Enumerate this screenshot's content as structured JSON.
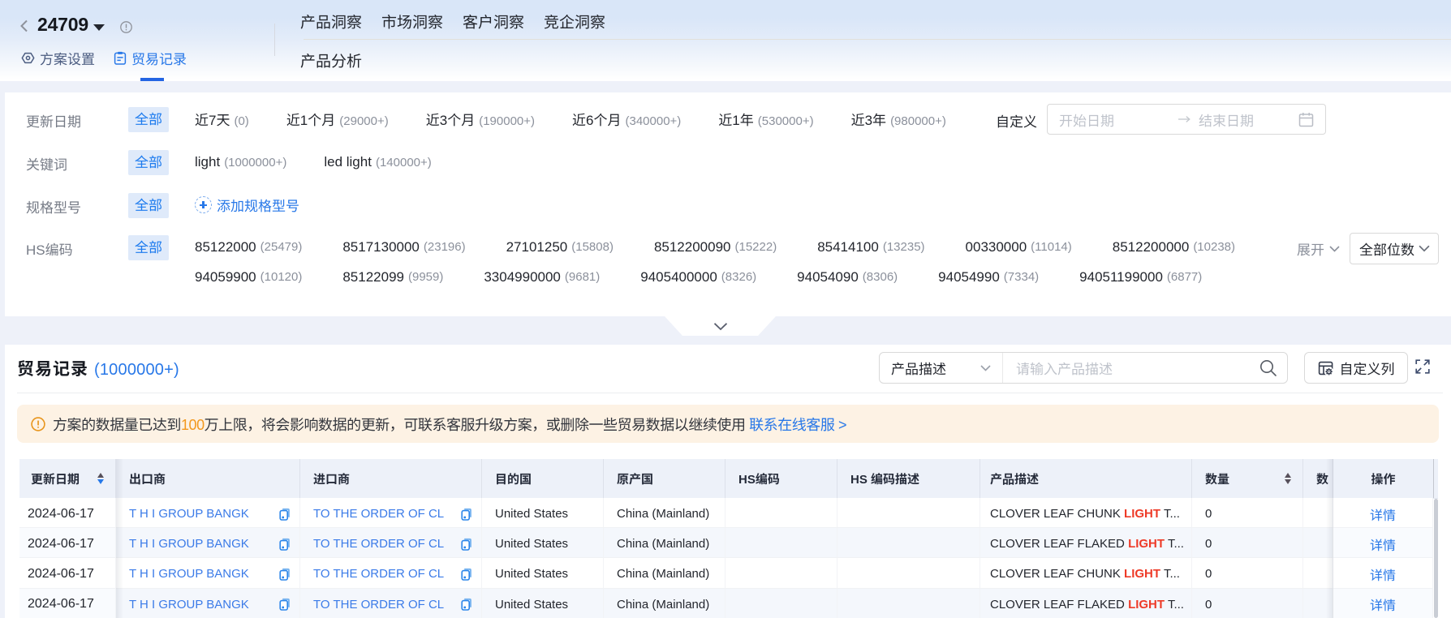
{
  "header": {
    "title": "24709",
    "plan_tabs": [
      {
        "label": "方案设置"
      },
      {
        "label": "贸易记录"
      }
    ],
    "nav_items": [
      "产品洞察",
      "市场洞察",
      "客户洞察",
      "竞企洞察"
    ],
    "subnav_items": [
      "产品分析"
    ]
  },
  "filters": {
    "all_label": "全部",
    "rows": {
      "update_date": {
        "label": "更新日期",
        "options": [
          {
            "text": "近7天",
            "count": "(0)"
          },
          {
            "text": "近1个月",
            "count": "(29000+)"
          },
          {
            "text": "近3个月",
            "count": "(190000+)"
          },
          {
            "text": "近6个月",
            "count": "(340000+)"
          },
          {
            "text": "近1年",
            "count": "(530000+)"
          },
          {
            "text": "近3年",
            "count": "(980000+)"
          }
        ],
        "custom_label": "自定义",
        "start_placeholder": "开始日期",
        "end_placeholder": "结束日期"
      },
      "keyword": {
        "label": "关键词",
        "options": [
          {
            "text": "light",
            "count": "(1000000+)"
          },
          {
            "text": "led light",
            "count": "(140000+)"
          }
        ]
      },
      "spec_model": {
        "label": "规格型号",
        "add_label": "添加规格型号"
      },
      "hs_code": {
        "label": "HS编码",
        "options": [
          {
            "text": "85122000",
            "count": "(25479)"
          },
          {
            "text": "8517130000",
            "count": "(23196)"
          },
          {
            "text": "27101250",
            "count": "(15808)"
          },
          {
            "text": "8512200090",
            "count": "(15222)"
          },
          {
            "text": "85414100",
            "count": "(13235)"
          },
          {
            "text": "00330000",
            "count": "(11014)"
          },
          {
            "text": "8512200000",
            "count": "(10238)"
          },
          {
            "text": "94059900",
            "count": "(10120)"
          },
          {
            "text": "85122099",
            "count": "(9959)"
          },
          {
            "text": "3304990000",
            "count": "(9681)"
          },
          {
            "text": "9405400000",
            "count": "(8326)"
          },
          {
            "text": "94054090",
            "count": "(8306)"
          },
          {
            "text": "94054990",
            "count": "(7334)"
          },
          {
            "text": "94051199000",
            "count": "(6877)"
          }
        ],
        "expand_label": "展开",
        "digits_select_value": "全部位数"
      }
    }
  },
  "records": {
    "title": "贸易记录",
    "count": "(1000000+)",
    "toolbar": {
      "field_select_value": "产品描述",
      "search_placeholder": "请输入产品描述",
      "customize_columns_label": "自定义列"
    },
    "notice": {
      "part1": "方案的数据量已达到",
      "highlight": "100",
      "part2": "万上限，将会影响数据的更新，可联系客服升级方案，或删除一些贸易数据以继续使用",
      "link": "联系在线客服 >"
    },
    "table": {
      "columns": {
        "update_date": "更新日期",
        "exporter": "出口商",
        "importer": "进口商",
        "destination": "目的国",
        "origin": "原产国",
        "hs_code": "HS编码",
        "hs_desc": "HS 编码描述",
        "product": "产品描述",
        "quantity": "数量",
        "clipped": "数",
        "action": "操作"
      },
      "rows": [
        {
          "date": "2024-06-17",
          "exporter": "T H I GROUP BANGK",
          "importer": "TO THE ORDER OF CL",
          "destination": "United States",
          "origin": "China (Mainland)",
          "hs_code": "",
          "hs_desc": "",
          "product_pre": "CLOVER LEAF CHUNK ",
          "product_hl": "LIGHT",
          "product_post": " T...",
          "quantity": "0",
          "action": "详情"
        },
        {
          "date": "2024-06-17",
          "exporter": "T H I GROUP BANGK",
          "importer": "TO THE ORDER OF CL",
          "destination": "United States",
          "origin": "China (Mainland)",
          "hs_code": "",
          "hs_desc": "",
          "product_pre": "CLOVER LEAF FLAKED ",
          "product_hl": "LIGHT",
          "product_post": " T...",
          "quantity": "0",
          "action": "详情"
        },
        {
          "date": "2024-06-17",
          "exporter": "T H I GROUP BANGK",
          "importer": "TO THE ORDER OF CL",
          "destination": "United States",
          "origin": "China (Mainland)",
          "hs_code": "",
          "hs_desc": "",
          "product_pre": "CLOVER LEAF CHUNK ",
          "product_hl": "LIGHT",
          "product_post": " T...",
          "quantity": "0",
          "action": "详情"
        },
        {
          "date": "2024-06-17",
          "exporter": "T H I GROUP BANGK",
          "importer": "TO THE ORDER OF CL",
          "destination": "United States",
          "origin": "China (Mainland)",
          "hs_code": "",
          "hs_desc": "",
          "product_pre": "CLOVER LEAF FLAKED ",
          "product_hl": "LIGHT",
          "product_post": " T...",
          "quantity": "0",
          "action": "详情"
        }
      ]
    }
  },
  "colors": {
    "accent_blue": "#2878e8",
    "link_blue": "#3b7be8",
    "highlight_red": "#ee3b28",
    "warning_orange": "#f2981d",
    "chip_bg": "#ddebfb",
    "banner_bg": "#fdf2e4",
    "page_bg": "#eef1f9",
    "table_header_bg": "#edf1f9",
    "zebra_bg": "#f4f7fc"
  }
}
